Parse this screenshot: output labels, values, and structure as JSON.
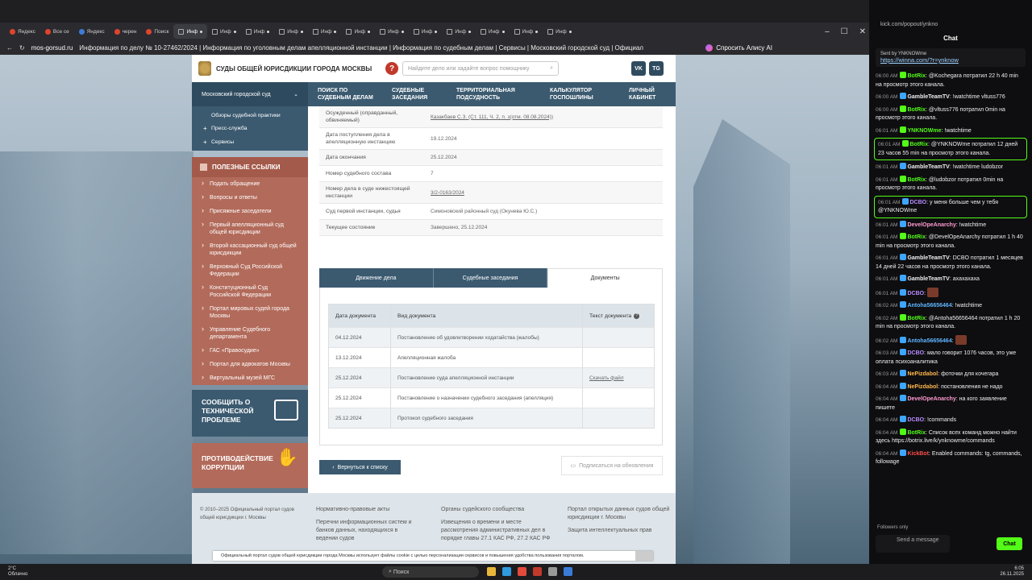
{
  "browser": {
    "tabs": [
      {
        "label": "Яндекс",
        "active": false
      },
      {
        "label": "Все се",
        "active": false
      },
      {
        "label": "Яндекс",
        "active": false
      },
      {
        "label": "черен",
        "active": false
      },
      {
        "label": "Поиск",
        "active": false
      },
      {
        "label": "Инф",
        "active": true
      },
      {
        "label": "Инф",
        "active": false
      },
      {
        "label": "Инф",
        "active": false
      },
      {
        "label": "Инф",
        "active": false
      },
      {
        "label": "Инф",
        "active": false
      },
      {
        "label": "Инф",
        "active": false
      },
      {
        "label": "Инф",
        "active": false
      },
      {
        "label": "Инф",
        "active": false
      },
      {
        "label": "Инф",
        "active": false
      },
      {
        "label": "Инф",
        "active": false
      },
      {
        "label": "Инф",
        "active": false
      },
      {
        "label": "Инф",
        "active": false
      }
    ],
    "domain": "mos-gorsud.ru",
    "page_title": "Информация по делу № 10-27462/2024 | Информация по уголовным делам апелляционной инстанции | Информация по судебным делам | Сервисы | Московский городской суд | Официальный...",
    "alice": "Спросить Алису AI"
  },
  "site": {
    "logo_title": "Суды общей юрисдикции города Москвы",
    "search_placeholder": "Найдите дело или задайте вопрос помощнику",
    "social": [
      "VK",
      "TG"
    ],
    "court_select": "Московский городской суд",
    "nav": [
      "ПОИСК ПО СУДЕБНЫМ ДЕЛАМ",
      "СУДЕБНЫЕ ЗАСЕДАНИЯ",
      "ТЕРРИТОРИАЛЬНАЯ ПОДСУДНОСТЬ",
      "КАЛЬКУЛЯТОР ГОСПОШЛИНЫ",
      "ЛИЧНЫЙ КАБИНЕТ"
    ],
    "sublinks": [
      "Обзоры судебной практики",
      "Пресс-служба",
      "Сервисы"
    ],
    "useful_title": "ПОЛЕЗНЫЕ ССЫЛКИ",
    "useful_links": [
      "Подать обращение",
      "Вопросы и ответы",
      "Присяжные заседатели",
      "Первый апелляционный суд общей юрисдикции",
      "Второй кассационный суд общей юрисдикции",
      "Верховный Суд Российской Федерации",
      "Конституционный Суд Российской Федерации",
      "Портал мировых судей города Москвы",
      "Управление Судебного департамента",
      "ГАС «Правосудие»",
      "Портал для адвокатов Москвы",
      "Виртуальный музей МГС"
    ],
    "report_banner": "СООБЩИТЬ О ТЕХНИЧЕСКОЙ ПРОБЛЕМЕ",
    "corruption_banner": "ПРОТИВОДЕЙСТВИЕ КОРРУПЦИИ",
    "info_rows": [
      {
        "key": "Осужденный (оправданный, обвиняемый)",
        "value": "Казакбаев С.З. (Ст. 111, Ч. 2, п. з(отм. 08.08.2024))",
        "link": true
      },
      {
        "key": "Дата поступления дела в апелляционную инстанцию",
        "value": "19.12.2024",
        "link": false
      },
      {
        "key": "Дата окончания",
        "value": "25.12.2024",
        "link": false
      },
      {
        "key": "Номер судебного состава",
        "value": "7",
        "link": false
      },
      {
        "key": "Номер дела в суде нижестоящей инстанции",
        "value": "3/2-0163/2024",
        "link": true
      },
      {
        "key": "Суд первой инстанции, судья",
        "value": "Симоновский районный суд (Окунева Ю.С.)",
        "link": false
      },
      {
        "key": "Текущее состояние",
        "value": "Завершено, 25.12.2024",
        "link": false
      }
    ],
    "tabs": [
      "Движение дела",
      "Судебные заседания",
      "Документы"
    ],
    "active_tab": "Документы",
    "doc_headers": [
      "Дата документа",
      "Вид документа",
      "Текст документа"
    ],
    "docs": [
      {
        "date": "04.12.2024",
        "type": "Постановление об удовлетворении ходатайства (жалобы)",
        "text": ""
      },
      {
        "date": "13.12.2024",
        "type": "Апелляционная жалоба",
        "text": ""
      },
      {
        "date": "25.12.2024",
        "type": "Постановление суда апелляционной инстанции",
        "text": "Скачать файл"
      },
      {
        "date": "25.12.2024",
        "type": "Постановление о назначении судебного заседания (апелляция)",
        "text": ""
      },
      {
        "date": "25.12.2024",
        "type": "Протокол судебного заседания",
        "text": ""
      }
    ],
    "back_button": "Вернуться к списку",
    "subscribe": "Подписаться на обновления",
    "footer": {
      "copyright": "© 2010–2025 Официальный портал судов общей юрисдикции г. Москвы",
      "col2a": "Нормативно-правовые акты",
      "col2b": "Перечни информационных систем и банков данных, находящихся в ведении судов",
      "col3a": "Органы судейского сообщества",
      "col3b": "Извещения о времени и месте рассмотрения административных дел в порядке главы 27.1 КАС РФ, 27.2 КАС РФ",
      "col4a": "Портал открытых данных судов общей юрисдикции г. Москвы",
      "col4b": "Защита интеллектуальных прав"
    },
    "cookie": "Официальный портал судов общей юрисдикции города Москвы использует файлы cookie с целью персонализации сервисов и повышения удобства пользования порталом."
  },
  "chat": {
    "url": "kick.com/popout/ynkno",
    "title": "Chat",
    "pinned_by": "Sent by YNKNOWme",
    "pinned_link": "https://winna.com/?r=ynknow",
    "messages": [
      {
        "ts": "06:00 AM",
        "user": "BotRix",
        "color": "#53fc18",
        "text": "@Kochegara потратил 22 h 40 min на просмотр этого канала.",
        "hl": false
      },
      {
        "ts": "06:00 AM",
        "user": "GambleTeamTV",
        "color": "#efeff1",
        "text": "!watchtime vltuss776",
        "hl": false
      },
      {
        "ts": "06:00 AM",
        "user": "BotRix",
        "color": "#53fc18",
        "text": "@vltuss776 потратил 0min на просмотр этого канала.",
        "hl": false
      },
      {
        "ts": "06:01 AM",
        "user": "YNKNOWme",
        "color": "#53fc18",
        "text": "!watchtime",
        "hl": false
      },
      {
        "ts": "06:01 AM",
        "user": "BotRix",
        "color": "#53fc18",
        "text": "@YNKNOWme потратил 12 дней 23 часов 55 min на просмотр этого канала.",
        "hl": true
      },
      {
        "ts": "06:01 AM",
        "user": "GambleTeamTV",
        "color": "#efeff1",
        "text": "!watchtime ludobzor",
        "hl": false
      },
      {
        "ts": "06:01 AM",
        "user": "BotRix",
        "color": "#53fc18",
        "text": "@ludobzor потратил 0min на просмотр этого канала.",
        "hl": false
      },
      {
        "ts": "06:01 AM",
        "user": "DCBO",
        "color": "#b88cff",
        "text": "у меня больше чем у тебя @YNKNOWme",
        "hl": true
      },
      {
        "ts": "06:01 AM",
        "user": "DevelOpeAnarchy",
        "color": "#ff9bd1",
        "text": "!watchtime",
        "hl": false
      },
      {
        "ts": "06:01 AM",
        "user": "BotRix",
        "color": "#53fc18",
        "text": "@DevelOpeAnarchy потратил 1 h 40 min на просмотр этого канала.",
        "hl": false
      },
      {
        "ts": "06:01 AM",
        "user": "GambleTeamTV",
        "color": "#efeff1",
        "text": "DCBO потратил 1 месяцев 14 дней 22 часов на просмотр этого канала.",
        "hl": false
      },
      {
        "ts": "06:01 AM",
        "user": "GambleTeamTV",
        "color": "#efeff1",
        "text": "ахахахаха",
        "hl": false
      },
      {
        "ts": "06:01 AM",
        "user": "DCBO",
        "color": "#b88cff",
        "text": "",
        "hl": false
      },
      {
        "ts": "06:02 AM",
        "user": "Antoha56656464",
        "color": "#5fb4ff",
        "text": "!watchtime",
        "hl": false
      },
      {
        "ts": "06:02 AM",
        "user": "BotRix",
        "color": "#53fc18",
        "text": "@Antoha56656464 потратил 1 h 20 min на просмотр этого канала.",
        "hl": false
      },
      {
        "ts": "06:02 AM",
        "user": "Antoha56656464",
        "color": "#5fb4ff",
        "text": "",
        "hl": false
      },
      {
        "ts": "06:03 AM",
        "user": "DCBO",
        "color": "#b88cff",
        "text": "мало говорит 1076 часов, это уже оплата психоаналитика",
        "hl": false
      },
      {
        "ts": "06:03 AM",
        "user": "NePizdabol",
        "color": "#ffb84d",
        "text": "фоточки для кочегара",
        "hl": false
      },
      {
        "ts": "06:04 AM",
        "user": "NePizdabol",
        "color": "#ffb84d",
        "text": "постановления не надо",
        "hl": false
      },
      {
        "ts": "06:04 AM",
        "user": "DevelOpeAnarchy",
        "color": "#ff9bd1",
        "text": "на кого заявление пишете",
        "hl": false
      },
      {
        "ts": "06:04 AM",
        "user": "DCBO",
        "color": "#b88cff",
        "text": "!commands",
        "hl": false
      },
      {
        "ts": "06:04 AM",
        "user": "BotRix",
        "color": "#53fc18",
        "text": "Список всех команд можно найти здесь https://botrix.live/k/ynknowme/commands",
        "hl": false
      },
      {
        "ts": "06:04 AM",
        "user": "KickBot",
        "color": "#ff4d4d",
        "text": "Enabled commands: tg, commands, followage",
        "hl": false
      }
    ],
    "followers_only": "Followers only",
    "input_placeholder": "Send a message",
    "send_button": "Chat"
  },
  "taskbar": {
    "weather_temp": "2°C",
    "weather_desc": "Облачно",
    "search": "Поиск",
    "time": "6:05",
    "date": "26.11.2025"
  }
}
